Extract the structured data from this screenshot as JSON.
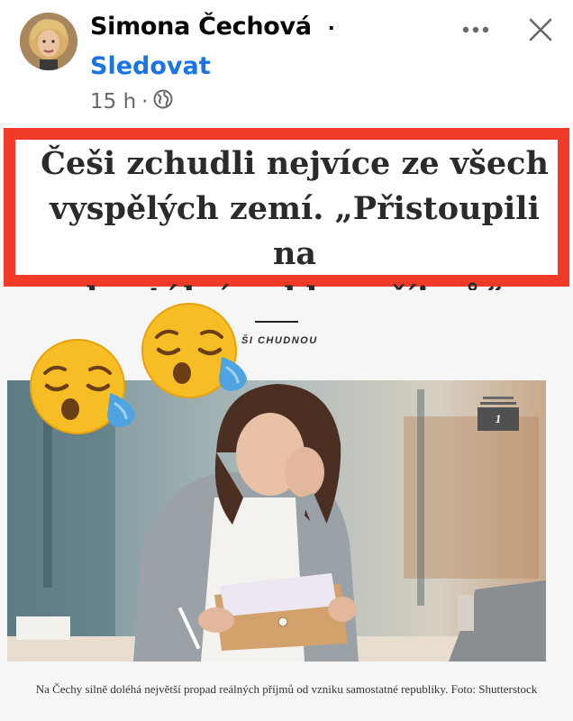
{
  "post": {
    "author": "Simona Čechová",
    "author_separator": "·",
    "follow_label": "Sledovat",
    "time": "15 h",
    "meta_separator": "·",
    "audience_icon": "globe-icon",
    "more_icon": "more-horizontal-icon",
    "close_icon": "close-icon"
  },
  "shared_image": {
    "headline": "Češi zchudli nejvíce ze všech\nvyspělých zemí. „Přistoupili na\nbrutální pokles příjmů“",
    "kicker": "ŠI CHUDNOU",
    "gallery_count": "1",
    "caption": "Na Čechy silně doléhá největší propad reálných příjmů od vzniku samostatné republiky. Foto: Shutterstock"
  },
  "stickers": [
    "sleepy-face-emoji",
    "sleepy-face-emoji"
  ],
  "colors": {
    "accent_blue": "#1b74e4",
    "headline_border": "#f23a28",
    "meta_gray": "#65676b",
    "emoji_yellow": "#f7bd25",
    "tear_blue": "#4fa3e0"
  }
}
